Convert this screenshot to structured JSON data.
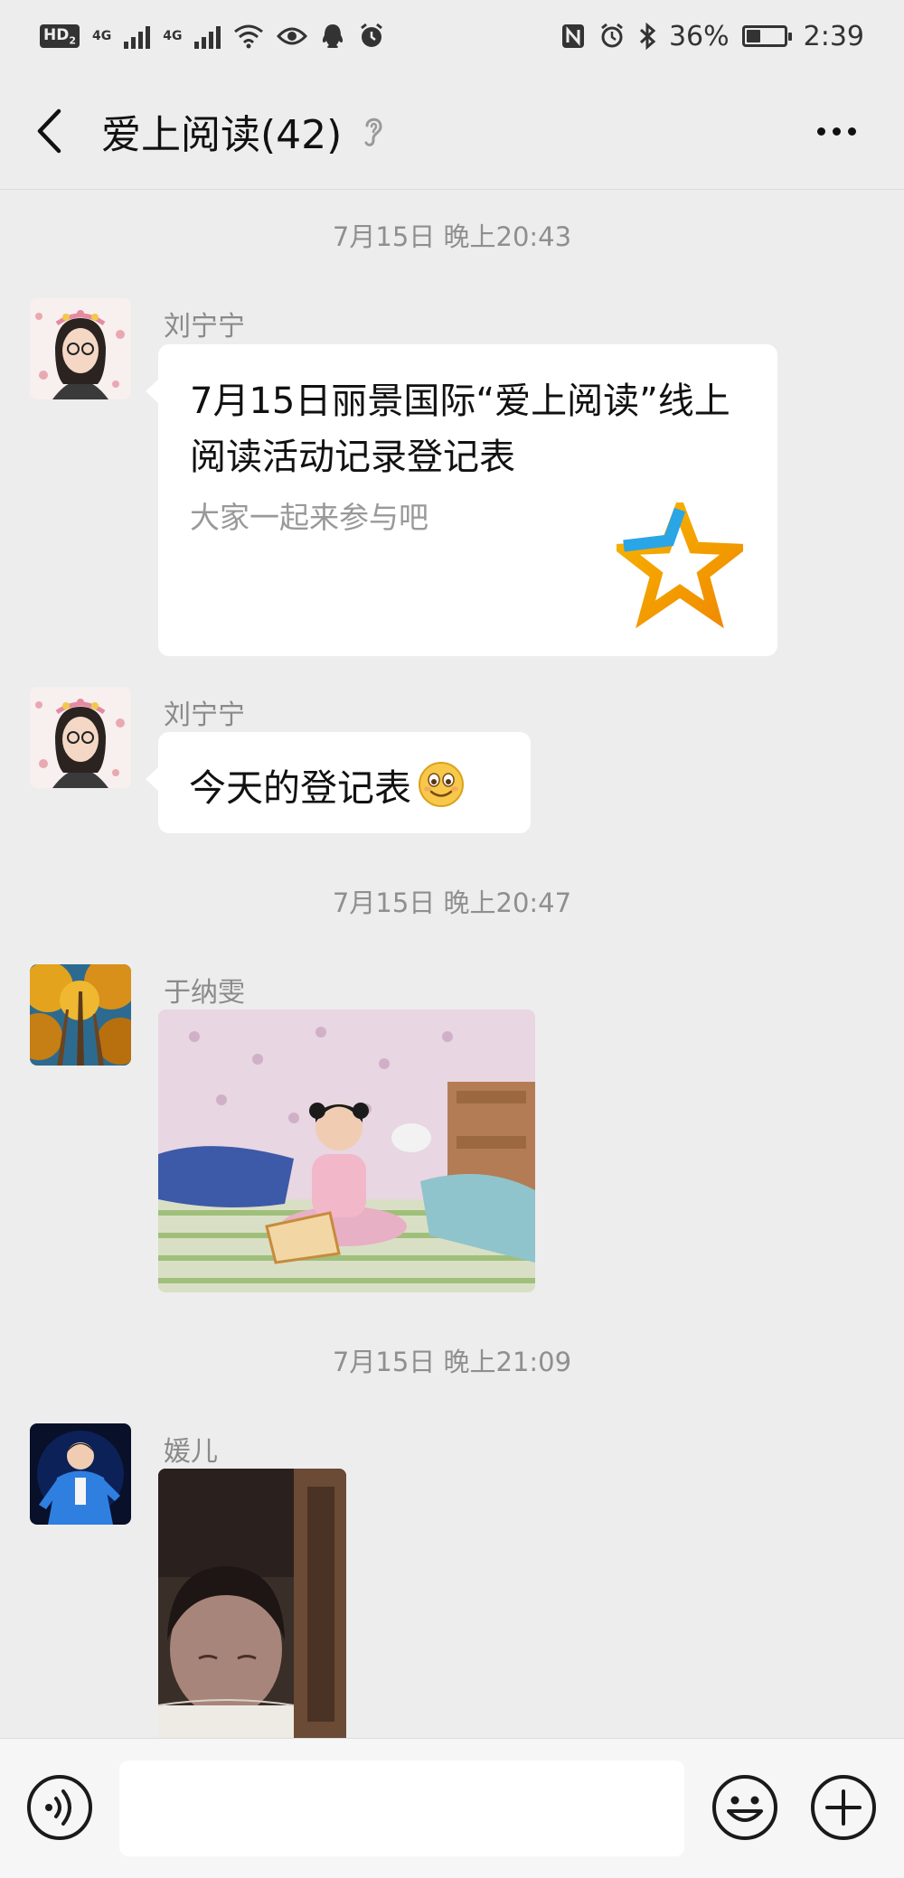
{
  "status_bar": {
    "left_badge": "HD",
    "left_badge_sub": "2",
    "network_1": "4G",
    "network_2": "4G",
    "battery": "36%",
    "battery_level": 0.36,
    "time": "2:39"
  },
  "header": {
    "title": "爱上阅读(42)",
    "back_icon": "chevron-left-icon",
    "mute_icon": "ear-icon",
    "more_icon": "more-dots-icon"
  },
  "messages": [
    {
      "type": "timestamp",
      "text": "7月15日 晚上20:43"
    },
    {
      "type": "link",
      "sender": "刘宁宁",
      "title": "7月15日丽景国际“爱上阅读”线上阅读活动记录登记表",
      "description": "大家一起来参与吧",
      "thumb_icon": "star-icon"
    },
    {
      "type": "text",
      "sender": "刘宁宁",
      "text": "今天的登记表",
      "emoji": "smile-emoji"
    },
    {
      "type": "timestamp",
      "text": "7月15日 晚上20:47"
    },
    {
      "type": "image",
      "sender": "于纳雯"
    },
    {
      "type": "timestamp",
      "text": "7月15日 晚上21:09"
    },
    {
      "type": "image",
      "sender": "媛儿"
    }
  ],
  "input_bar": {
    "voice_icon": "voice-icon",
    "placeholder": "",
    "emoji_icon": "emoji-icon",
    "plus_icon": "plus-icon"
  },
  "colors": {
    "background": "#ededed",
    "bubble": "#ffffff",
    "timestamp_text": "#8f8f8f",
    "sender_text": "#8a8a8a"
  }
}
